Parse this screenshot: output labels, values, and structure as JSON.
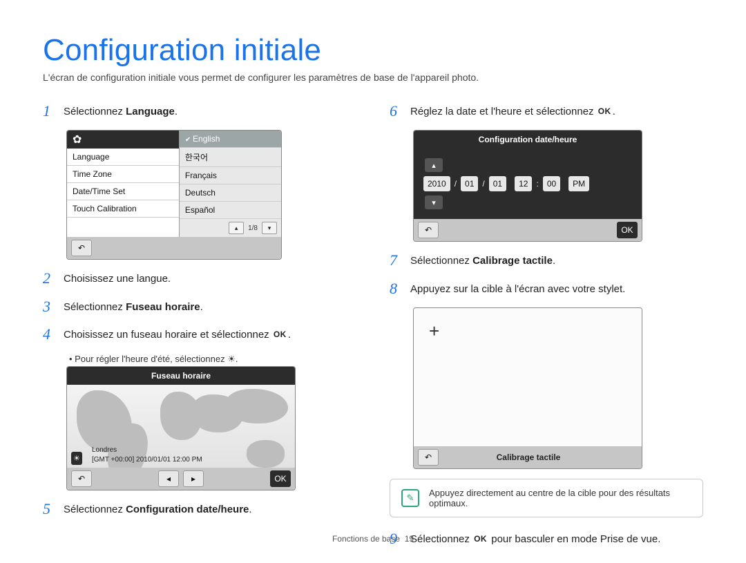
{
  "page": {
    "title": "Configuration initiale",
    "intro": "L'écran de configuration initiale vous permet de configurer les paramètres de base de l'appareil photo."
  },
  "steps": {
    "s1": {
      "num": "1",
      "pre": "Sélectionnez ",
      "bold": "Language",
      "post": "."
    },
    "s2": {
      "num": "2",
      "text": "Choisissez une langue."
    },
    "s3": {
      "num": "3",
      "pre": "Sélectionnez ",
      "bold": "Fuseau horaire",
      "post": "."
    },
    "s4": {
      "num": "4",
      "pre": "Choisissez un fuseau horaire et sélectionnez ",
      "ok": true,
      "post": "."
    },
    "s4_sub": "Pour régler l'heure d'été, sélectionnez ",
    "s5": {
      "num": "5",
      "pre": "Sélectionnez ",
      "bold": "Configuration date/heure",
      "post": "."
    },
    "s6": {
      "num": "6",
      "pre": "Réglez la date et l'heure et sélectionnez ",
      "ok": true,
      "post": "."
    },
    "s7": {
      "num": "7",
      "pre": "Sélectionnez ",
      "bold": "Calibrage tactile",
      "post": "."
    },
    "s8": {
      "num": "8",
      "text": "Appuyez sur la cible à l'écran avec votre stylet."
    },
    "s9": {
      "num": "9",
      "pre": "Sélectionnez ",
      "ok": true,
      "post": " pour basculer en mode Prise de vue."
    }
  },
  "screen_lang": {
    "left": [
      "Language",
      "Time Zone",
      "Date/Time Set",
      "Touch Calibration"
    ],
    "right": [
      "English",
      "한국어",
      "Français",
      "Deutsch",
      "Español"
    ],
    "pager": "1/8"
  },
  "screen_tz": {
    "title": "Fuseau horaire",
    "city": "Londres",
    "gmt": "[GMT +00:00] 2010/01/01 12:00 PM"
  },
  "screen_dt": {
    "title": "Configuration date/heure",
    "fields": [
      "2010",
      "/",
      "01",
      "/",
      "01",
      " ",
      "12",
      ":",
      "00",
      " ",
      "PM"
    ]
  },
  "screen_cal": {
    "footer_label": "Calibrage tactile"
  },
  "note": "Appuyez directement au centre de la cible pour des résultats optimaux.",
  "ok_glyph": "OK",
  "footer": {
    "section": "Fonctions de base",
    "page": "19"
  }
}
